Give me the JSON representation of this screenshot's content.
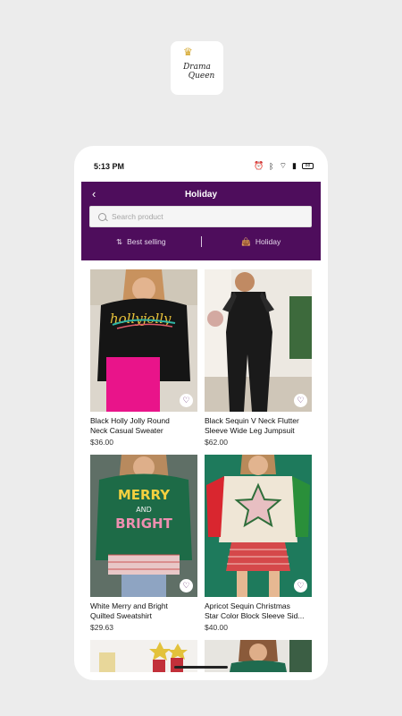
{
  "status": {
    "time": "5:13 PM",
    "battery": "88"
  },
  "header": {
    "title": "Holiday"
  },
  "search": {
    "placeholder": "Search product"
  },
  "filters": [
    {
      "label": "Best selling"
    },
    {
      "label": "Holiday"
    }
  ],
  "products": [
    {
      "name_line1": "Black Holly Jolly Round",
      "name_line2": "Neck Casual Sweater",
      "price": "$36.00"
    },
    {
      "name_line1": "Black Sequin V Neck Flutter",
      "name_line2": "Sleeve Wide Leg Jumpsuit",
      "price": "$62.00"
    },
    {
      "name_line1": "White Merry and Bright",
      "name_line2": "Quilted Sweatshirt",
      "price": "$29.63"
    },
    {
      "name_line1": "Apricot Sequin Christmas",
      "name_line2": "Star Color Block Sleeve Sid...",
      "price": "$40.00"
    }
  ],
  "images": {
    "p1_text": "hollyjolly",
    "p3_line1": "MERRY",
    "p3_line2": "AND",
    "p3_line3": "BRIGHT"
  },
  "colors": {
    "accent": "#4e0d5c",
    "background": "#ececec"
  }
}
